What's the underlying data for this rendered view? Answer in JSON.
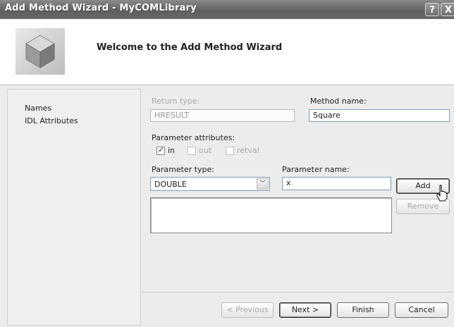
{
  "window": {
    "title": "Add Method Wizard - MyCOMLibrary",
    "help_glyph": "?",
    "close_glyph": "X"
  },
  "header": {
    "title": "Welcome to the Add Method Wizard",
    "icon": "wizard-cube-icon"
  },
  "nav": {
    "items": [
      {
        "label": "Names"
      },
      {
        "label": "IDL Attributes"
      }
    ]
  },
  "form": {
    "return_type": {
      "label": "Return type:",
      "value": "HRESULT"
    },
    "method_name": {
      "label": "Method name:",
      "value": "Square"
    },
    "parameter_attributes": {
      "label": "Parameter attributes:",
      "options": [
        {
          "label": "in",
          "checked": true
        },
        {
          "label": "out",
          "checked": false
        },
        {
          "label": "retval",
          "checked": false
        }
      ]
    },
    "parameter_type": {
      "label": "Parameter type:",
      "value": "DOUBLE"
    },
    "parameter_name": {
      "label": "Parameter name:",
      "value": "x"
    },
    "add_label": "Add",
    "remove_label": "Remove"
  },
  "buttons": {
    "previous": "< Previous",
    "next": "Next >",
    "finish": "Finish",
    "cancel": "Cancel"
  }
}
